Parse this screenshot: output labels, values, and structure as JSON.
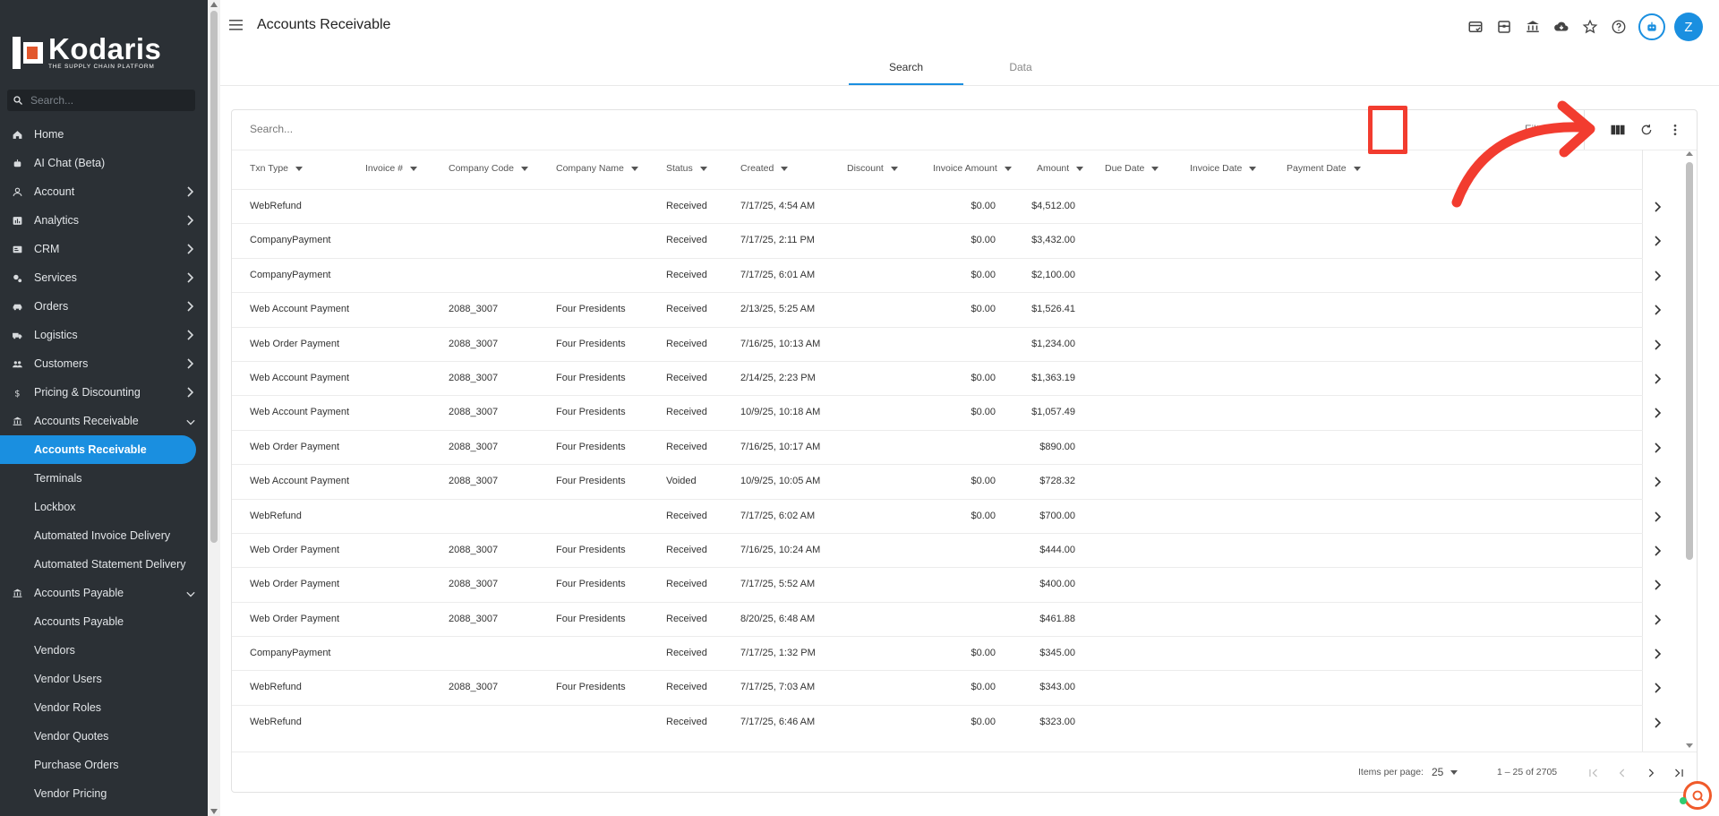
{
  "brand": {
    "name": "Kodaris",
    "tagline": "THE SUPPLY CHAIN PLATFORM"
  },
  "sidebar": {
    "search_placeholder": "Search...",
    "items": [
      {
        "label": "Home",
        "icon": "home-icon",
        "chevron": ""
      },
      {
        "label": "AI Chat (Beta)",
        "icon": "robot-icon",
        "chevron": ""
      },
      {
        "label": "Account",
        "icon": "person-icon",
        "chevron": "right"
      },
      {
        "label": "Analytics",
        "icon": "chart-icon",
        "chevron": "right"
      },
      {
        "label": "CRM",
        "icon": "contact-card-icon",
        "chevron": "right"
      },
      {
        "label": "Services",
        "icon": "gears-icon",
        "chevron": "right"
      },
      {
        "label": "Orders",
        "icon": "car-icon",
        "chevron": "right"
      },
      {
        "label": "Logistics",
        "icon": "truck-icon",
        "chevron": "right"
      },
      {
        "label": "Customers",
        "icon": "people-icon",
        "chevron": "right"
      },
      {
        "label": "Pricing & Discounting",
        "icon": "dollar-icon",
        "chevron": "right"
      },
      {
        "label": "Accounts Receivable",
        "icon": "bank-icon",
        "chevron": "down"
      }
    ],
    "ar_sub": [
      "Accounts Receivable",
      "Terminals",
      "Lockbox",
      "Automated Invoice Delivery",
      "Automated Statement Delivery"
    ],
    "ap_item": {
      "label": "Accounts Payable",
      "icon": "bank-icon",
      "chevron": "down"
    },
    "ap_sub": [
      "Accounts Payable",
      "Vendors",
      "Vendor Users",
      "Vendor Roles",
      "Vendor Quotes",
      "Purchase Orders",
      "Vendor Pricing"
    ]
  },
  "header": {
    "title": "Accounts Receivable",
    "avatar_initial": "Z",
    "icons": [
      "payment-card-icon",
      "inventory-icon",
      "bank-icon",
      "cloud-download-icon",
      "star-icon",
      "help-icon",
      "bot-icon"
    ]
  },
  "tabs": [
    {
      "label": "Search",
      "active": true
    },
    {
      "label": "Data",
      "active": false
    }
  ],
  "table": {
    "search_placeholder": "Search...",
    "filters_label": "Filters",
    "columns": [
      "Txn Type",
      "Invoice #",
      "Company Code",
      "Company Name",
      "Status",
      "Created",
      "Discount",
      "Invoice Amount",
      "Amount",
      "Due Date",
      "Invoice Date",
      "Payment Date"
    ],
    "rows": [
      {
        "txn_type": "WebRefund",
        "invoice": "",
        "company_code": "",
        "company_name": "",
        "status": "Received",
        "created": "7/17/25, 4:54 AM",
        "discount": "",
        "invoice_amount": "$0.00",
        "amount": "$4,512.00"
      },
      {
        "txn_type": "CompanyPayment",
        "invoice": "",
        "company_code": "",
        "company_name": "",
        "status": "Received",
        "created": "7/17/25, 2:11 PM",
        "discount": "",
        "invoice_amount": "$0.00",
        "amount": "$3,432.00"
      },
      {
        "txn_type": "CompanyPayment",
        "invoice": "",
        "company_code": "",
        "company_name": "",
        "status": "Received",
        "created": "7/17/25, 6:01 AM",
        "discount": "",
        "invoice_amount": "$0.00",
        "amount": "$2,100.00"
      },
      {
        "txn_type": "Web Account Payment",
        "invoice": "",
        "company_code": "2088_3007",
        "company_name": "Four Presidents",
        "status": "Received",
        "created": "2/13/25, 5:25 AM",
        "discount": "",
        "invoice_amount": "$0.00",
        "amount": "$1,526.41"
      },
      {
        "txn_type": "Web Order Payment",
        "invoice": "",
        "company_code": "2088_3007",
        "company_name": "Four Presidents",
        "status": "Received",
        "created": "7/16/25, 10:13 AM",
        "discount": "",
        "invoice_amount": "",
        "amount": "$1,234.00"
      },
      {
        "txn_type": "Web Account Payment",
        "invoice": "",
        "company_code": "2088_3007",
        "company_name": "Four Presidents",
        "status": "Received",
        "created": "2/14/25, 2:23 PM",
        "discount": "",
        "invoice_amount": "$0.00",
        "amount": "$1,363.19"
      },
      {
        "txn_type": "Web Account Payment",
        "invoice": "",
        "company_code": "2088_3007",
        "company_name": "Four Presidents",
        "status": "Received",
        "created": "10/9/25, 10:18 AM",
        "discount": "",
        "invoice_amount": "$0.00",
        "amount": "$1,057.49"
      },
      {
        "txn_type": "Web Order Payment",
        "invoice": "",
        "company_code": "2088_3007",
        "company_name": "Four Presidents",
        "status": "Received",
        "created": "7/16/25, 10:17 AM",
        "discount": "",
        "invoice_amount": "",
        "amount": "$890.00"
      },
      {
        "txn_type": "Web Account Payment",
        "invoice": "",
        "company_code": "2088_3007",
        "company_name": "Four Presidents",
        "status": "Voided",
        "created": "10/9/25, 10:05 AM",
        "discount": "",
        "invoice_amount": "$0.00",
        "amount": "$728.32"
      },
      {
        "txn_type": "WebRefund",
        "invoice": "",
        "company_code": "",
        "company_name": "",
        "status": "Received",
        "created": "7/17/25, 6:02 AM",
        "discount": "",
        "invoice_amount": "$0.00",
        "amount": "$700.00"
      },
      {
        "txn_type": "Web Order Payment",
        "invoice": "",
        "company_code": "2088_3007",
        "company_name": "Four Presidents",
        "status": "Received",
        "created": "7/16/25, 10:24 AM",
        "discount": "",
        "invoice_amount": "",
        "amount": "$444.00"
      },
      {
        "txn_type": "Web Order Payment",
        "invoice": "",
        "company_code": "2088_3007",
        "company_name": "Four Presidents",
        "status": "Received",
        "created": "7/17/25, 5:52 AM",
        "discount": "",
        "invoice_amount": "",
        "amount": "$400.00"
      },
      {
        "txn_type": "Web Order Payment",
        "invoice": "",
        "company_code": "2088_3007",
        "company_name": "Four Presidents",
        "status": "Received",
        "created": "8/20/25, 6:48 AM",
        "discount": "",
        "invoice_amount": "",
        "amount": "$461.88"
      },
      {
        "txn_type": "CompanyPayment",
        "invoice": "",
        "company_code": "",
        "company_name": "",
        "status": "Received",
        "created": "7/17/25, 1:32 PM",
        "discount": "",
        "invoice_amount": "$0.00",
        "amount": "$345.00"
      },
      {
        "txn_type": "WebRefund",
        "invoice": "",
        "company_code": "2088_3007",
        "company_name": "Four Presidents",
        "status": "Received",
        "created": "7/17/25, 7:03 AM",
        "discount": "",
        "invoice_amount": "$0.00",
        "amount": "$343.00"
      },
      {
        "txn_type": "WebRefund",
        "invoice": "",
        "company_code": "",
        "company_name": "",
        "status": "Received",
        "created": "7/17/25, 6:46 AM",
        "discount": "",
        "invoice_amount": "$0.00",
        "amount": "$323.00"
      }
    ]
  },
  "pagination": {
    "items_per_page_label": "Items per page:",
    "items_per_page": "25",
    "range_label": "1 – 25 of 2705"
  },
  "colors": {
    "accent": "#1a8fe0",
    "sidebar_bg": "#2b3035",
    "annotation": "#f23c2f",
    "brand_orange": "#e2572c"
  }
}
